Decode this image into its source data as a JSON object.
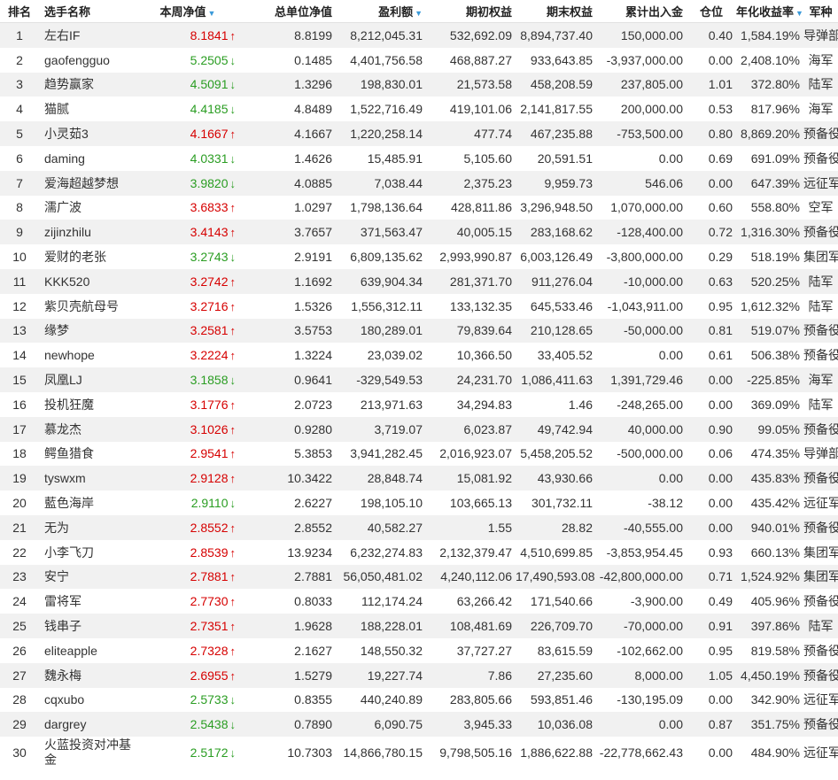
{
  "headers": [
    "排名",
    "选手名称",
    "本周净值",
    "总单位净值",
    "盈利额",
    "期初权益",
    "期末权益",
    "累计出入金",
    "仓位",
    "年化收益率",
    "军种"
  ],
  "rows": [
    [
      "1",
      "左右IF",
      "8.1841",
      "up",
      "8.8199",
      "8,212,045.31",
      "532,692.09",
      "8,894,737.40",
      "150,000.00",
      "0.40",
      "1,584.19%",
      "导弹部队"
    ],
    [
      "2",
      "gaofengguo",
      "5.2505",
      "down",
      "0.1485",
      "4,401,756.58",
      "468,887.27",
      "933,643.85",
      "-3,937,000.00",
      "0.00",
      "2,408.10%",
      "海军"
    ],
    [
      "3",
      "趋势赢家",
      "4.5091",
      "down",
      "1.3296",
      "198,830.01",
      "21,573.58",
      "458,208.59",
      "237,805.00",
      "1.01",
      "372.80%",
      "陆军"
    ],
    [
      "4",
      "猫腻",
      "4.4185",
      "down",
      "4.8489",
      "1,522,716.49",
      "419,101.06",
      "2,141,817.55",
      "200,000.00",
      "0.53",
      "817.96%",
      "海军"
    ],
    [
      "5",
      "小灵茹3",
      "4.1667",
      "up",
      "4.1667",
      "1,220,258.14",
      "477.74",
      "467,235.88",
      "-753,500.00",
      "0.80",
      "8,869.20%",
      "预备役"
    ],
    [
      "6",
      "daming",
      "4.0331",
      "down",
      "1.4626",
      "15,485.91",
      "5,105.60",
      "20,591.51",
      "0.00",
      "0.69",
      "691.09%",
      "预备役"
    ],
    [
      "7",
      "爱海超越梦想",
      "3.9820",
      "down",
      "4.0885",
      "7,038.44",
      "2,375.23",
      "9,959.73",
      "546.06",
      "0.00",
      "647.39%",
      "远征军"
    ],
    [
      "8",
      "濡广波",
      "3.6833",
      "up",
      "1.0297",
      "1,798,136.64",
      "428,811.86",
      "3,296,948.50",
      "1,070,000.00",
      "0.60",
      "558.80%",
      "空军"
    ],
    [
      "9",
      "zijinzhilu",
      "3.4143",
      "up",
      "3.7657",
      "371,563.47",
      "40,005.15",
      "283,168.62",
      "-128,400.00",
      "0.72",
      "1,316.30%",
      "预备役"
    ],
    [
      "10",
      "爱财的老张",
      "3.2743",
      "down",
      "2.9191",
      "6,809,135.62",
      "2,993,990.87",
      "6,003,126.49",
      "-3,800,000.00",
      "0.29",
      "518.19%",
      "集团军"
    ],
    [
      "11",
      "KKK520",
      "3.2742",
      "up",
      "1.1692",
      "639,904.34",
      "281,371.70",
      "911,276.04",
      "-10,000.00",
      "0.63",
      "520.25%",
      "陆军"
    ],
    [
      "12",
      "紫贝壳航母号",
      "3.2716",
      "up",
      "1.5326",
      "1,556,312.11",
      "133,132.35",
      "645,533.46",
      "-1,043,911.00",
      "0.95",
      "1,612.32%",
      "陆军"
    ],
    [
      "13",
      "缘梦",
      "3.2581",
      "up",
      "3.5753",
      "180,289.01",
      "79,839.64",
      "210,128.65",
      "-50,000.00",
      "0.81",
      "519.07%",
      "预备役"
    ],
    [
      "14",
      "newhope",
      "3.2224",
      "up",
      "1.3224",
      "23,039.02",
      "10,366.50",
      "33,405.52",
      "0.00",
      "0.61",
      "506.38%",
      "预备役"
    ],
    [
      "15",
      "凤凰LJ",
      "3.1858",
      "down",
      "0.9641",
      "-329,549.53",
      "24,231.70",
      "1,086,411.63",
      "1,391,729.46",
      "0.00",
      "-225.85%",
      "海军"
    ],
    [
      "16",
      "投机狂魔",
      "3.1776",
      "up",
      "2.0723",
      "213,971.63",
      "34,294.83",
      "1.46",
      "-248,265.00",
      "0.00",
      "369.09%",
      "陆军"
    ],
    [
      "17",
      "慕龙杰",
      "3.1026",
      "up",
      "0.9280",
      "3,719.07",
      "6,023.87",
      "49,742.94",
      "40,000.00",
      "0.90",
      "99.05%",
      "预备役"
    ],
    [
      "18",
      "鳄鱼猎食",
      "2.9541",
      "up",
      "5.3853",
      "3,941,282.45",
      "2,016,923.07",
      "5,458,205.52",
      "-500,000.00",
      "0.06",
      "474.35%",
      "导弹部队"
    ],
    [
      "19",
      "tyswxm",
      "2.9128",
      "up",
      "10.3422",
      "28,848.74",
      "15,081.92",
      "43,930.66",
      "0.00",
      "0.00",
      "435.83%",
      "预备役"
    ],
    [
      "20",
      "藍色海岸",
      "2.9110",
      "down",
      "2.6227",
      "198,105.10",
      "103,665.13",
      "301,732.11",
      "-38.12",
      "0.00",
      "435.42%",
      "远征军"
    ],
    [
      "21",
      "无为",
      "2.8552",
      "up",
      "2.8552",
      "40,582.27",
      "1.55",
      "28.82",
      "-40,555.00",
      "0.00",
      "940.01%",
      "预备役"
    ],
    [
      "22",
      "小李飞刀",
      "2.8539",
      "up",
      "13.9234",
      "6,232,274.83",
      "2,132,379.47",
      "4,510,699.85",
      "-3,853,954.45",
      "0.93",
      "660.13%",
      "集团军"
    ],
    [
      "23",
      "安宁",
      "2.7881",
      "up",
      "2.7881",
      "56,050,481.02",
      "4,240,112.06",
      "17,490,593.08",
      "-42,800,000.00",
      "0.71",
      "1,524.92%",
      "集团军"
    ],
    [
      "24",
      "雷将军",
      "2.7730",
      "up",
      "0.8033",
      "112,174.24",
      "63,266.42",
      "171,540.66",
      "-3,900.00",
      "0.49",
      "405.96%",
      "预备役"
    ],
    [
      "25",
      "钱串子",
      "2.7351",
      "up",
      "1.9628",
      "188,228.01",
      "108,481.69",
      "226,709.70",
      "-70,000.00",
      "0.91",
      "397.86%",
      "陆军"
    ],
    [
      "26",
      "eliteapple",
      "2.7328",
      "up",
      "2.1627",
      "148,550.32",
      "37,727.27",
      "83,615.59",
      "-102,662.00",
      "0.95",
      "819.58%",
      "预备役"
    ],
    [
      "27",
      "魏永梅",
      "2.6955",
      "up",
      "1.5279",
      "19,227.74",
      "7.86",
      "27,235.60",
      "8,000.00",
      "1.05",
      "4,450.19%",
      "预备役"
    ],
    [
      "28",
      "cqxubo",
      "2.5733",
      "down",
      "0.8355",
      "440,240.89",
      "283,805.66",
      "593,851.46",
      "-130,195.09",
      "0.00",
      "342.90%",
      "远征军"
    ],
    [
      "29",
      "dargrey",
      "2.5438",
      "down",
      "0.7890",
      "6,090.75",
      "3,945.33",
      "10,036.08",
      "0.00",
      "0.87",
      "351.75%",
      "预备役"
    ],
    [
      "30",
      "火蓝投资对冲基金",
      "2.5172",
      "down",
      "10.7303",
      "14,866,780.15",
      "9,798,505.16",
      "1,886,622.88",
      "-22,778,662.43",
      "0.00",
      "484.90%",
      "远征军"
    ]
  ],
  "icons": {
    "sort": "sort-down-icon",
    "up": "red-up-arrow-icon",
    "down": "green-down-arrow-icon"
  },
  "colors": {
    "up": "#d60000",
    "down": "#2a9d22",
    "sort": "#3b9ad9"
  }
}
